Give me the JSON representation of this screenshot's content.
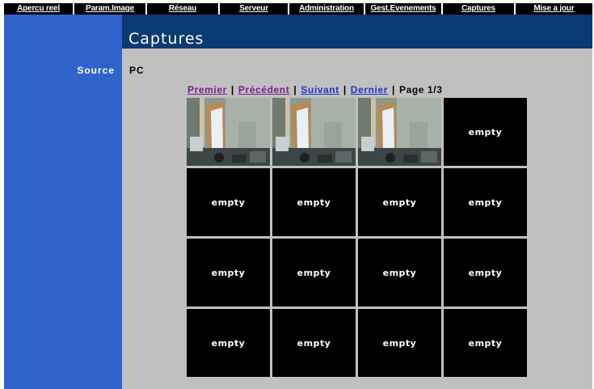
{
  "nav": {
    "items": [
      {
        "label": "Apercu reel"
      },
      {
        "label": "Param.Image"
      },
      {
        "label": "Réseau"
      },
      {
        "label": "Serveur"
      },
      {
        "label": "Administration"
      },
      {
        "label": "Gest.Evenements"
      },
      {
        "label": "Captures"
      },
      {
        "label": "Mise a jour"
      }
    ]
  },
  "page": {
    "title": "Captures"
  },
  "source": {
    "label": "Source",
    "value": "PC"
  },
  "pager": {
    "first": "Premier",
    "previous": "Précédent",
    "next": "Suivant",
    "last": "Dernier",
    "separator": "|",
    "page_indicator": "Page 1/3"
  },
  "captures": {
    "cells": [
      {
        "kind": "image"
      },
      {
        "kind": "image"
      },
      {
        "kind": "image"
      },
      {
        "kind": "empty",
        "label": "empty"
      },
      {
        "kind": "empty",
        "label": "empty"
      },
      {
        "kind": "empty",
        "label": "empty"
      },
      {
        "kind": "empty",
        "label": "empty"
      },
      {
        "kind": "empty",
        "label": "empty"
      },
      {
        "kind": "empty",
        "label": "empty"
      },
      {
        "kind": "empty",
        "label": "empty"
      },
      {
        "kind": "empty",
        "label": "empty"
      },
      {
        "kind": "empty",
        "label": "empty"
      },
      {
        "kind": "empty",
        "label": "empty"
      },
      {
        "kind": "empty",
        "label": "empty"
      },
      {
        "kind": "empty",
        "label": "empty"
      },
      {
        "kind": "empty",
        "label": "empty"
      }
    ]
  },
  "colors": {
    "nav_bg": "#000000",
    "sidebar": "#2f63cc",
    "title_bar": "#0a3a72",
    "content_bg": "#c0c0c0",
    "visited_link": "#7a1d8f",
    "link": "#2233cc"
  }
}
